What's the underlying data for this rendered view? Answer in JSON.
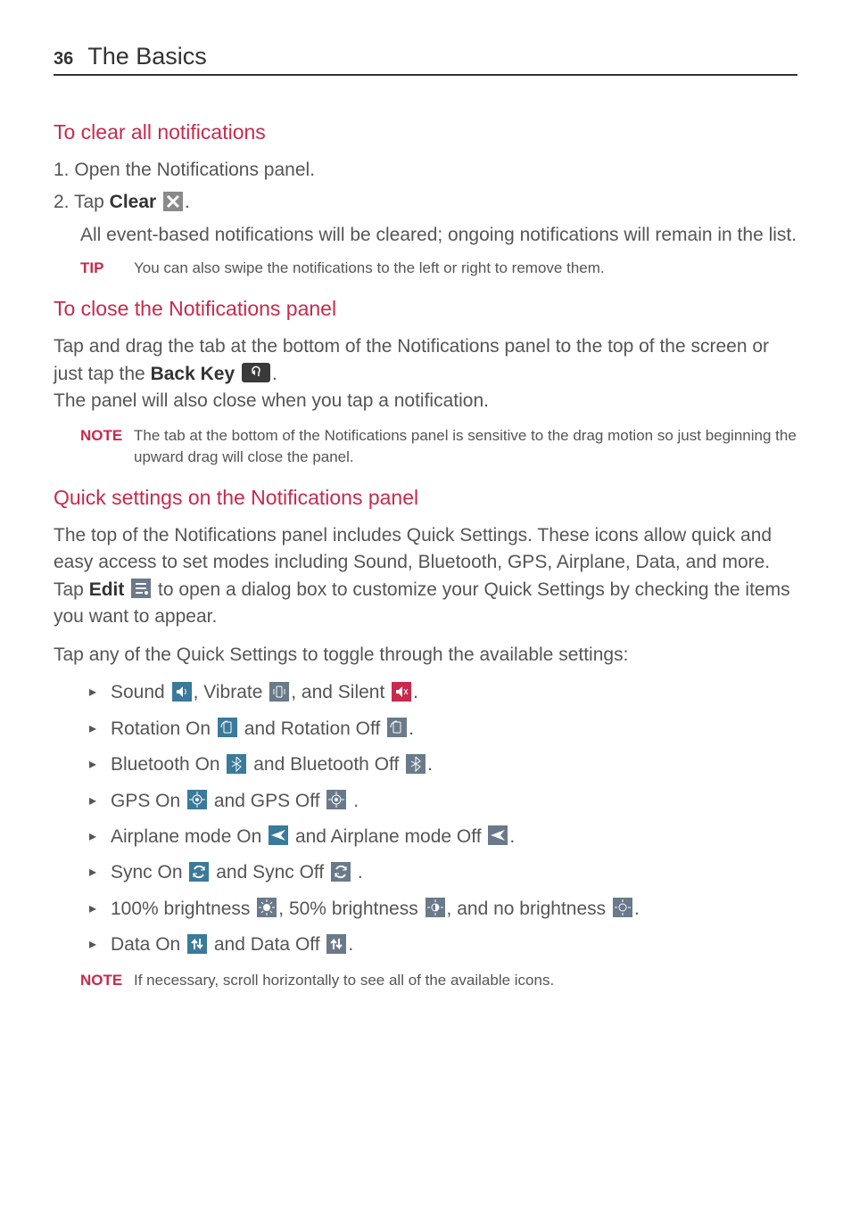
{
  "header": {
    "page_number": "36",
    "chapter_title": "The Basics"
  },
  "sections": {
    "clear_notifications": {
      "title": "To clear all notifications",
      "step1_num": "1. ",
      "step1_text": "Open the Notifications panel.",
      "step2_num": "2. ",
      "step2_prefix": "Tap ",
      "step2_bold": "Clear",
      "step2_suffix": ".",
      "step2_body": "All event-based notifications will be cleared; ongoing notifications will remain in the list.",
      "tip_label": "TIP",
      "tip_text": "You can also swipe the notifications to the left or right to remove them."
    },
    "close_panel": {
      "title": "To close the Notifications panel",
      "para1_a": "Tap and drag the tab at the bottom of the Notifications panel to the top of the screen or just tap the ",
      "para1_bold": "Back Key",
      "para1_c": ".",
      "para2": "The panel will also close when you tap a notification.",
      "note_label": "NOTE",
      "note_text": "The tab at the bottom of the Notifications panel is sensitive to the drag motion so just beginning the upward drag will close the panel."
    },
    "quick_settings": {
      "title": "Quick settings on the Notifications panel",
      "intro_a": "The top of the Notifications panel includes Quick Settings. These icons allow quick and easy access to set modes including Sound, Bluetooth, GPS, Airplane, Data, and more. Tap ",
      "intro_bold": "Edit",
      "intro_b": " to open a dialog box to customize your Quick Settings by checking the items you want to appear.",
      "tap_any": "Tap any of the Quick Settings to toggle through the available settings:",
      "bullets": {
        "sound_a": "Sound ",
        "sound_b": ", Vibrate ",
        "sound_c": ", and Silent ",
        "rotation_a": "Rotation On ",
        "rotation_b": " and Rotation Off ",
        "bluetooth_a": "Bluetooth On ",
        "bluetooth_b": " and Bluetooth Off ",
        "gps_a": "GPS On ",
        "gps_b": " and GPS Off ",
        "airplane_a": "Airplane mode On ",
        "airplane_b": " and Airplane mode Off ",
        "sync_a": "Sync On ",
        "sync_b": " and Sync Off ",
        "bright_a": "100% brightness ",
        "bright_b": ", 50% brightness ",
        "bright_c": ", and no brightness ",
        "data_a": "Data On ",
        "data_b": " and Data Off ",
        "period": "."
      },
      "note_label": "NOTE",
      "note_text": "If necessary, scroll horizontally to see all of the available icons."
    }
  }
}
